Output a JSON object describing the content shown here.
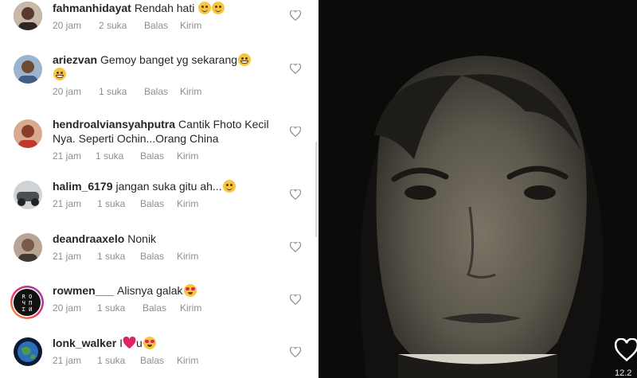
{
  "comments": [
    {
      "username": "fahmanhidayat",
      "text": "Rendah hati",
      "emojis": [
        "smile-emoji",
        "smile-emoji"
      ],
      "time": "20 jam",
      "likes": "2 suka",
      "reply": "Balas",
      "send": "Kirim",
      "avatar_color": "#5b3a2e"
    },
    {
      "username": "ariezvan",
      "text": "Gemoy banget yg sekarang",
      "emojis": [
        "grin-emoji",
        "grin-emoji"
      ],
      "time": "20 jam",
      "likes": "1 suka",
      "reply": "Balas",
      "send": "Kirim",
      "avatar_color": "#3f5f86"
    },
    {
      "username": "hendroalviansyahputra",
      "text": "Cantik Fhoto Kecil Nya. Seperti Ochin...Orang China",
      "emojis": [],
      "time": "21 jam",
      "likes": "1 suka",
      "reply": "Balas",
      "send": "Kirim",
      "avatar_color": "#8a3b2c"
    },
    {
      "username": "halim_6179",
      "text": "jangan suka gitu ah...",
      "emojis": [
        "slight-smile-emoji"
      ],
      "time": "21 jam",
      "likes": "1 suka",
      "reply": "Balas",
      "send": "Kirim",
      "avatar_color": "#4b4f55"
    },
    {
      "username": "deandraaxelo",
      "text": "Nonik",
      "emojis": [],
      "time": "21 jam",
      "likes": "1 suka",
      "reply": "Balas",
      "send": "Kirim",
      "avatar_color": "#7a5a48"
    },
    {
      "username": "rowmen___",
      "text": "Alisnya galak",
      "emojis": [
        "heart-eyes-emoji"
      ],
      "time": "20 jam",
      "likes": "1 suka",
      "reply": "Balas",
      "send": "Kirim",
      "avatar_color": "#111111",
      "avatar_text": "RO UH EN",
      "avatar_ring": "#c13584"
    },
    {
      "username": "lonk_walker",
      "text": "I",
      "emojis": [
        "red-heart-emoji"
      ],
      "text_after": "u",
      "emojis_after": [
        "heart-eyes-emoji"
      ],
      "time": "21 jam",
      "likes": "1 suka",
      "reply": "Balas",
      "send": "Kirim",
      "avatar_color": "#2a6fb8"
    }
  ],
  "overlay": {
    "time": "12.2"
  },
  "colors": {
    "username": "#262626",
    "meta": "#8e8e8e",
    "emoji_yellow": "#f7c640",
    "heart_red": "#e0245e"
  }
}
